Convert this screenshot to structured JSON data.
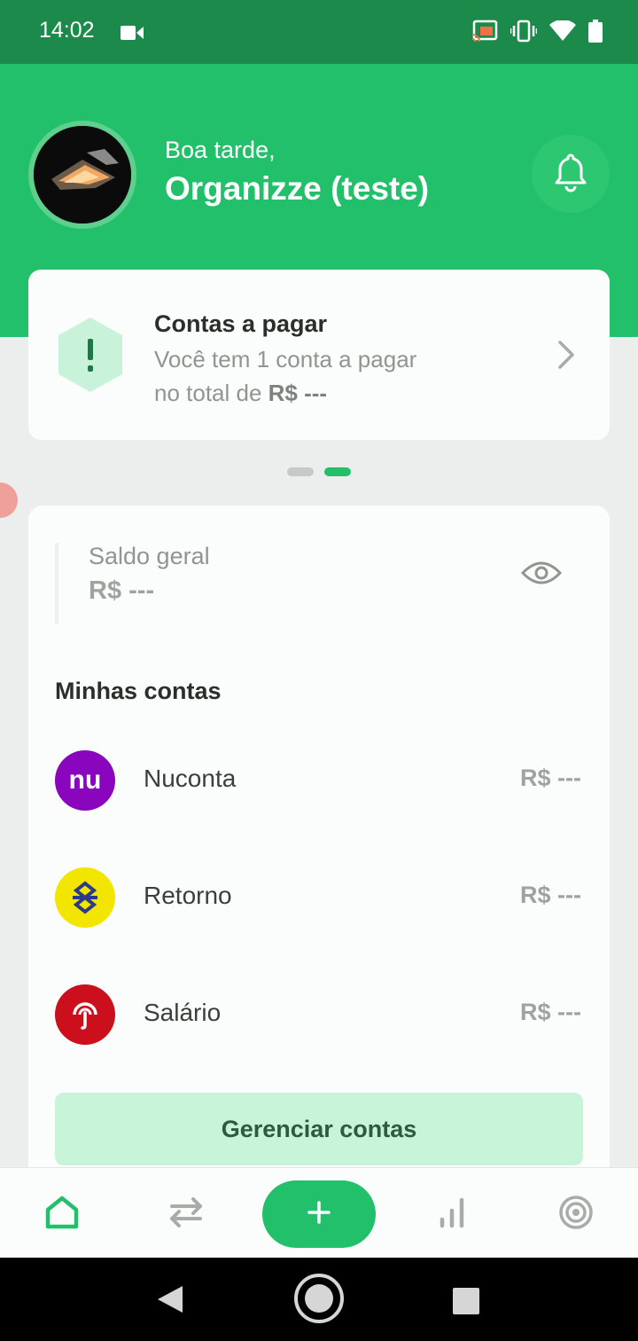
{
  "status_bar": {
    "time": "14:02",
    "icons": [
      "video-camera-icon",
      "cast-icon",
      "vibrate-icon",
      "wifi-icon",
      "battery-icon"
    ]
  },
  "header": {
    "greeting": "Boa tarde,",
    "user_name": "Organizze (teste)",
    "notification_icon": "bell-icon",
    "background_color": "#22c06a"
  },
  "bills_card": {
    "title": "Contas a pagar",
    "description_line1": "Você tem 1 conta a pagar",
    "description_prefix": "no total de ",
    "description_amount": "R$ ---",
    "icon": "alert-icon",
    "action_icon": "chevron-right-icon"
  },
  "carousel": {
    "page_count": 2,
    "active_page": 2
  },
  "balance": {
    "label": "Saldo geral",
    "value": "R$ ---",
    "visibility_icon": "eye-icon"
  },
  "accounts": {
    "section_title": "Minhas contas",
    "items": [
      {
        "name": "Nuconta",
        "value": "R$ ---",
        "logo_text": "nu",
        "logo_color": "#8a05be"
      },
      {
        "name": "Retorno",
        "value": "R$ ---",
        "logo_color": "#f2e600"
      },
      {
        "name": "Salário",
        "value": "R$ ---",
        "logo_color": "#cc0f1d"
      }
    ],
    "manage_label": "Gerenciar contas"
  },
  "bottom_nav": {
    "items": [
      "home-icon",
      "transactions-icon",
      "add-icon",
      "reports-icon",
      "goals-icon"
    ],
    "active": "home-icon",
    "accent_color": "#22c06a"
  },
  "system_nav": {
    "items": [
      "back-icon",
      "home-circle-icon",
      "recents-icon"
    ]
  }
}
